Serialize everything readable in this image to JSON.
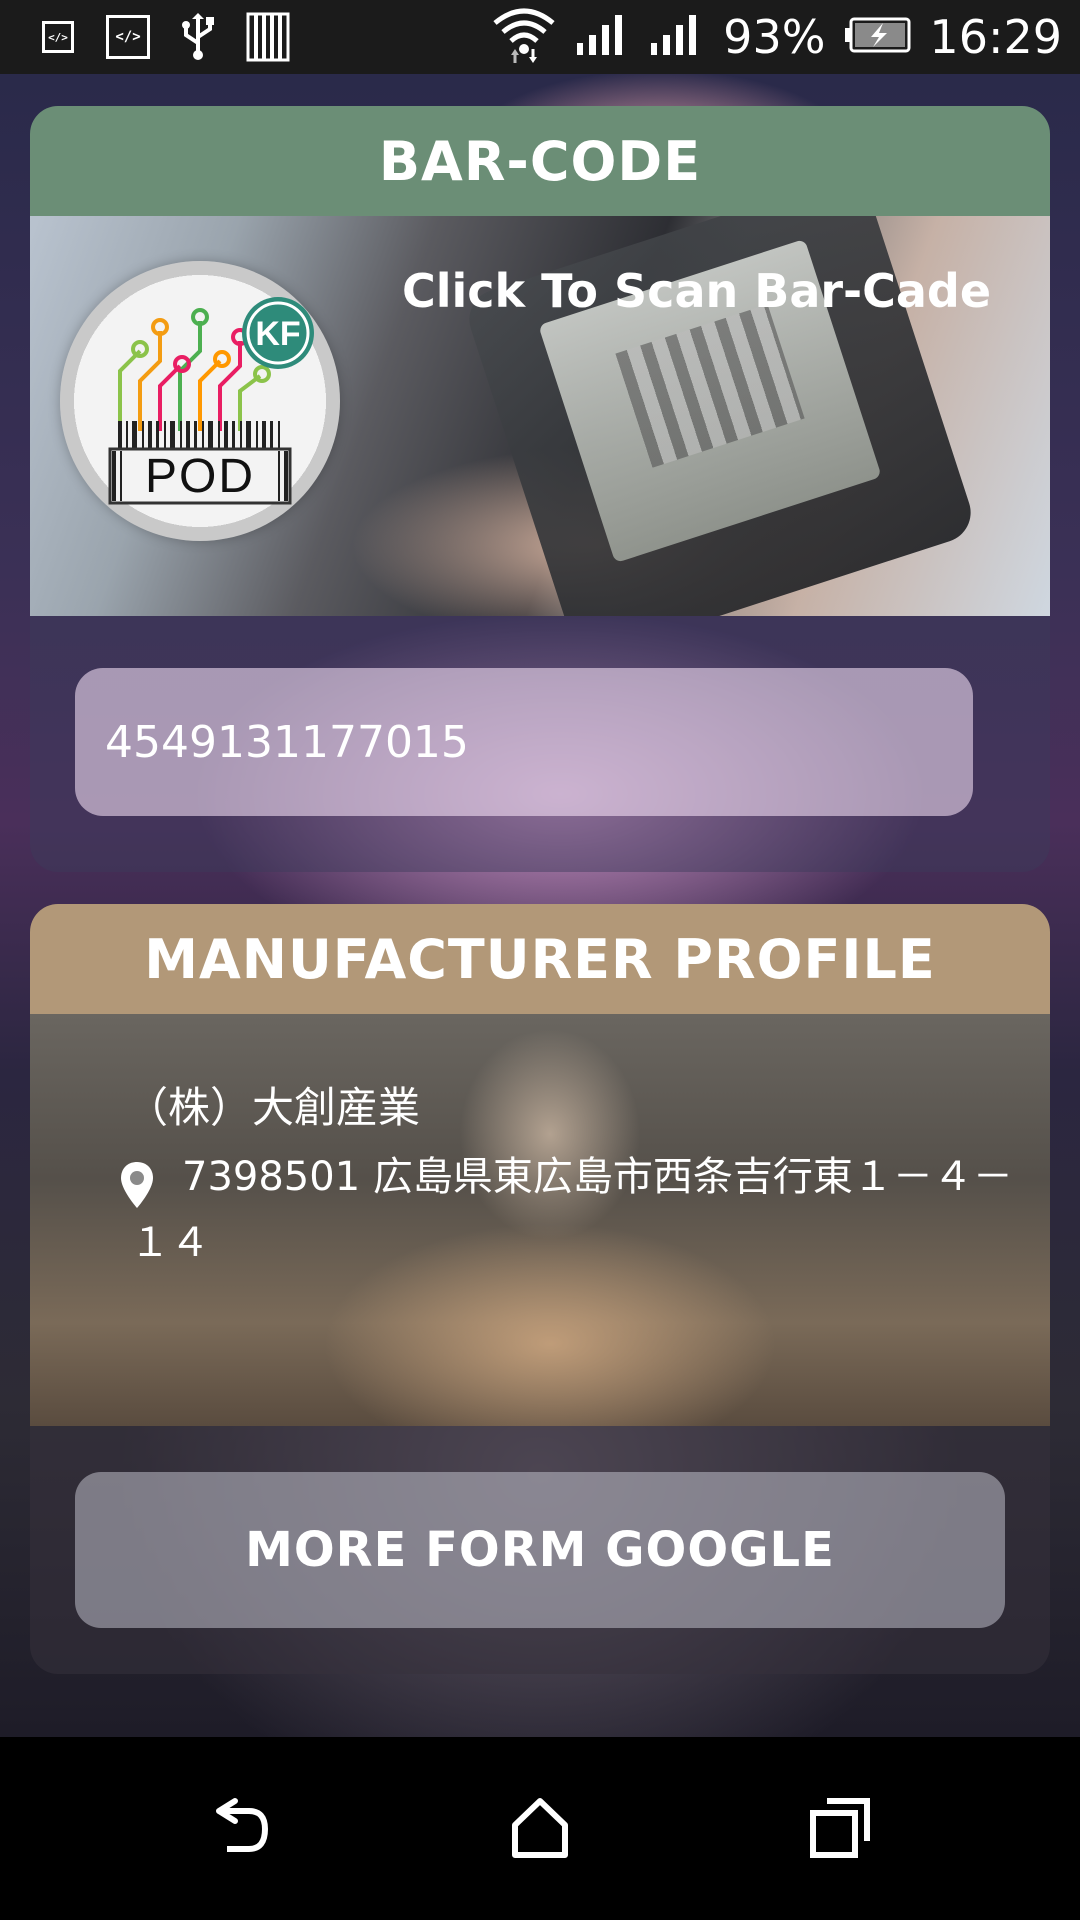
{
  "status_bar": {
    "left_icons": [
      "dev-mode-icon",
      "code-icon",
      "usb-icon",
      "storage-icon"
    ],
    "dev_icon_text": "</>",
    "battery_percent": "93%",
    "time": "16:29"
  },
  "barcode_card": {
    "title": "BAR-CODE",
    "scan_label": "Click To Scan Bar-Cade",
    "logo_text": "POD",
    "barcode_value": "4549131177015"
  },
  "manufacturer_card": {
    "title": "MANUFACTURER PROFILE",
    "company_name": "（株）大創産業",
    "address": "7398501 広島県東広島市西条吉行東１－４－１４"
  },
  "more_button_label": "MORE FORM GOOGLE",
  "colors": {
    "barcode_header": "#6b8e76",
    "manufacturer_header": "#b29878"
  },
  "nav": [
    "back-icon",
    "home-icon",
    "recents-icon"
  ]
}
